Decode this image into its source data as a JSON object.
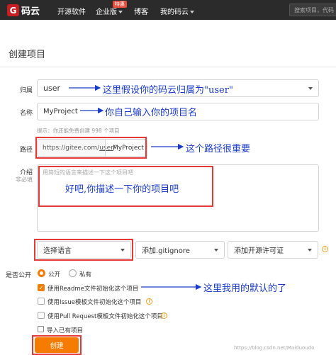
{
  "nav": {
    "logo_letter": "G",
    "logo_text": "码云",
    "items": [
      "开源软件",
      "企业版",
      "博客",
      "我的码云"
    ],
    "badge": "特惠",
    "search_placeholder": "搜索项目，代码"
  },
  "page_title": "创建项目",
  "form": {
    "owner": {
      "label": "归属",
      "value": "user"
    },
    "name": {
      "label": "名称",
      "value": "MyProject"
    },
    "hint": "提示：你还能免费创建 998 个项目",
    "path": {
      "label": "路径",
      "prefix_a": "https://gitee.com/",
      "prefix_user": "user",
      "prefix_b": "/",
      "value": "MyProject"
    },
    "intro": {
      "label": "介绍",
      "sublabel": "非必填",
      "placeholder": "用简短的语言来描述一下这个项目吧"
    },
    "language": "选择语言",
    "gitignore": "添加.gitignore",
    "license": "添加开源许可证",
    "visibility": {
      "label": "是否公开",
      "public": "公开",
      "private": "私有"
    },
    "options": [
      "使用Readme文件初始化这个项目",
      "使用Issue模板文件初始化这个项目",
      "使用Pull Request模板文件初始化这个项目"
    ],
    "import": "导入已有项目",
    "submit": "创建"
  },
  "annotations": {
    "owner_a": "这里假设你的码云归属为",
    "owner_b": "\"user\"",
    "name": "你自己输入你的项目名",
    "path": "这个路径很重要",
    "intro": "好吧,你描述一下你的项目吧",
    "readme": "这里我用的默认的了"
  },
  "colors": {
    "nav_bg": "#2b2b2b",
    "accent": "#f57c00",
    "annotation": "#1a3cc8",
    "highlight": "#e53935"
  },
  "watermark": "https://blog.csdn.net/Maiduoudo"
}
